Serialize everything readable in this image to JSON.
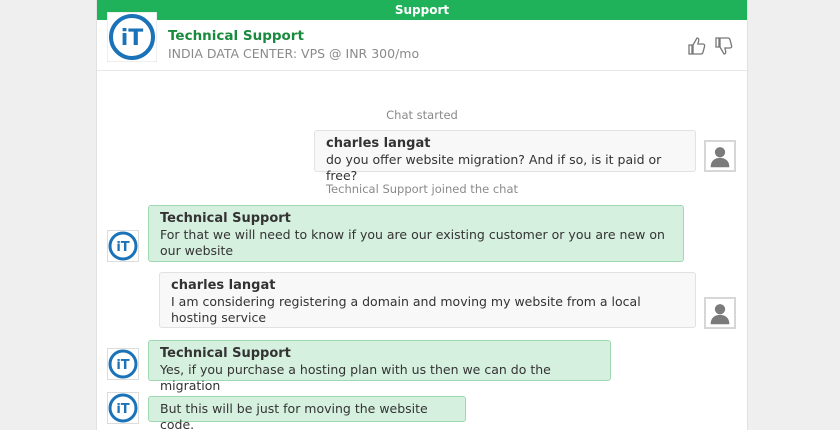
{
  "topbar": {
    "title": "Support"
  },
  "header": {
    "agent_name": "Technical Support",
    "subtitle": "INDIA DATA CENTER: VPS @ INR 300/mo",
    "logo_text": "iT"
  },
  "colors": {
    "brand_green": "#20b25a",
    "agent_bubble": "#d6f0df",
    "user_bubble": "#f8f8f8"
  },
  "messages": {
    "chat_started": "Chat started",
    "m1": {
      "sender": "charles langat",
      "text": "do you offer website migration? And if so, is it paid or free?"
    },
    "joined": "Technical Support joined the chat",
    "m2": {
      "sender": "Technical Support",
      "text": "For that we will need to know if you are our existing customer or you are new on our website"
    },
    "m3": {
      "sender": "charles langat",
      "text": "I am considering registering a domain and moving my website from a local hosting service"
    },
    "m4": {
      "sender": "Technical Support",
      "text": "Yes, if you purchase a hosting plan with us then we can do the migration"
    },
    "m5": {
      "text": "But this will be just for moving the website code."
    }
  }
}
